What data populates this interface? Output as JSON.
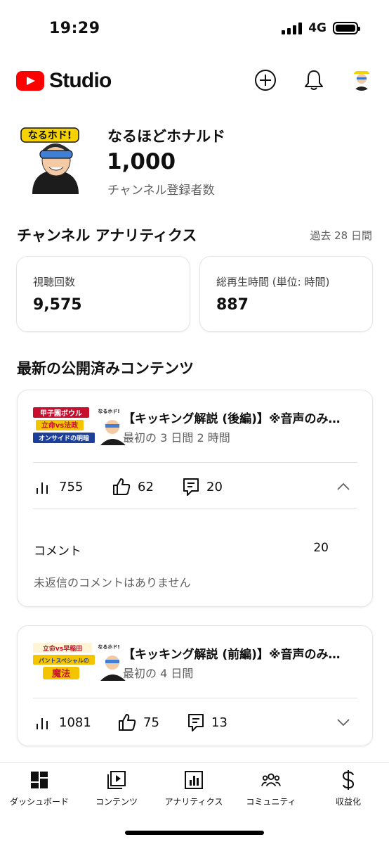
{
  "status_bar": {
    "time": "19:29",
    "network": "4G"
  },
  "header": {
    "logo_text": "Studio"
  },
  "channel": {
    "avatar_text": "なるホド!",
    "name": "なるほどホナルド",
    "subscriber_count": "1,000",
    "subscriber_label": "チャンネル登録者数"
  },
  "analytics": {
    "title": "チャンネル アナリティクス",
    "period": "過去 28 日間",
    "views_label": "視聴回数",
    "views_value": "9,575",
    "watch_time_label": "総再生時間 (単位: 時間)",
    "watch_time_value": "887"
  },
  "latest": {
    "title": "最新の公開済みコンテンツ",
    "items": [
      {
        "thumb_lines": [
          "甲子園ボウル",
          "立命vs法政",
          "オンサイドの明暗"
        ],
        "thumb_badge": "なるホド!",
        "title": "【キッキング解説 (後編)】※音声のみ…",
        "subtitle": "最初の 3 日間 2 時間",
        "views": "755",
        "likes": "62",
        "comments": "20",
        "expanded": true,
        "comments_section_label": "コメント",
        "comments_section_count": "20",
        "no_reply_text": "未返信のコメントはありません"
      },
      {
        "thumb_lines": [
          "立命vs早稲田",
          "パントスペシャルの",
          "魔法"
        ],
        "thumb_badge": "なるホド!",
        "title": "【キッキング解説 (前編)】※音声のみ…",
        "subtitle": "最初の 4 日間",
        "views": "1081",
        "likes": "75",
        "comments": "13",
        "expanded": false
      }
    ]
  },
  "bottom_nav": [
    {
      "label": "ダッシュボード",
      "icon": "dashboard-icon"
    },
    {
      "label": "コンテンツ",
      "icon": "content-icon"
    },
    {
      "label": "アナリティクス",
      "icon": "analytics-icon"
    },
    {
      "label": "コミュニティ",
      "icon": "community-icon"
    },
    {
      "label": "収益化",
      "icon": "dollar-icon"
    }
  ],
  "colors": {
    "brand_red": "#ff0000",
    "text": "#0f0f0f",
    "secondary_text": "#606060"
  }
}
